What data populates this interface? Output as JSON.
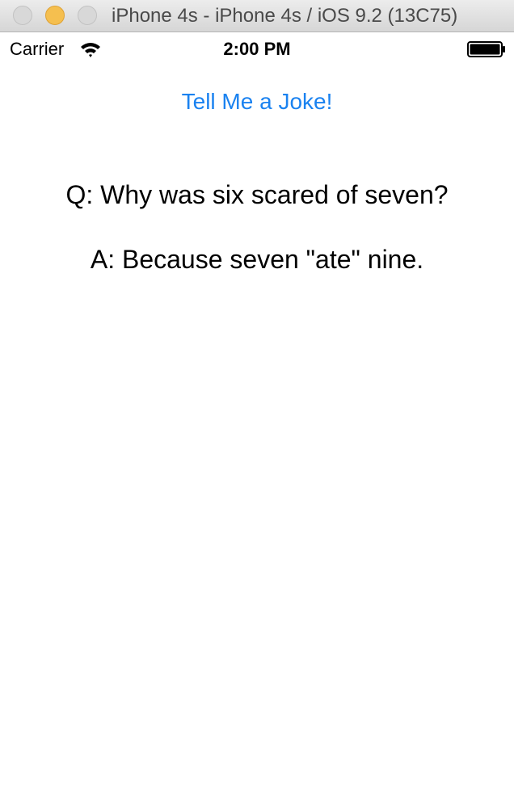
{
  "window": {
    "title": "iPhone 4s - iPhone 4s / iOS 9.2 (13C75)"
  },
  "status_bar": {
    "carrier": "Carrier",
    "time": "2:00 PM",
    "wifi_icon": "wifi-icon",
    "battery_icon": "battery-icon"
  },
  "app": {
    "button_label": "Tell Me a Joke!",
    "question": "Q: Why was six scared of seven?",
    "answer": "A: Because seven \"ate\" nine.",
    "accent_color": "#1a82f0"
  }
}
